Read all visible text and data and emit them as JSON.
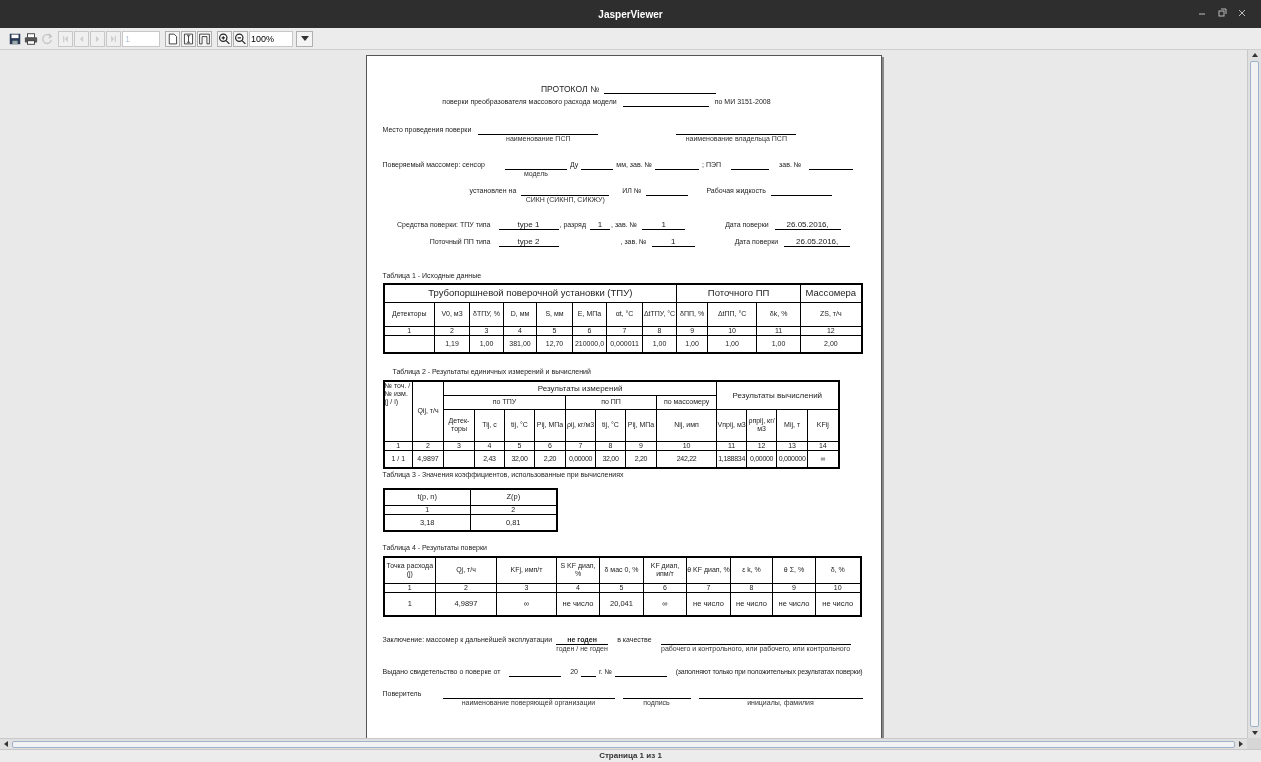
{
  "window": {
    "title": "JasperViewer"
  },
  "toolbar": {
    "buttons": [
      {
        "kind": "save",
        "disabled": false
      },
      {
        "kind": "print",
        "disabled": false
      },
      {
        "kind": "reload",
        "disabled": true
      },
      {
        "kind": "first",
        "disabled": true
      },
      {
        "kind": "previous",
        "disabled": true
      },
      {
        "kind": "next",
        "disabled": true
      },
      {
        "kind": "last",
        "disabled": true
      }
    ],
    "page_field": {
      "value": "1",
      "disabled": true
    },
    "view_buttons": [
      {
        "kind": "actual-size"
      },
      {
        "kind": "fit-page"
      },
      {
        "kind": "fit-width"
      }
    ],
    "zoom_buttons": [
      {
        "kind": "zoom-in"
      },
      {
        "kind": "zoom-out"
      }
    ],
    "zoom": "100%"
  },
  "report": {
    "heading": "ПРОТОКОЛ №",
    "model_line": {
      "before": "поверки преобразователя массового расхода модели",
      "after": "по МИ 3151-2008"
    },
    "place": {
      "label": "Место проведения поверки",
      "captions": [
        "наименование ПСП",
        "наименование владельца ПСП"
      ]
    },
    "meter": {
      "label": "Поверяемый массомер: сенсор",
      "model_caption": "модель",
      "du": "Ду",
      "mm_serial": "мм, зав. №",
      "pep": "; ПЭП",
      "serial": "зав. №"
    },
    "installed": {
      "label": "установлен на",
      "caption": "СИКН (СИКНП, СИКЖУ)",
      "il": "ИЛ №",
      "fluid": "Рабочая жидкость"
    },
    "means": [
      {
        "label": "Средства поверки: ТПУ типа",
        "type": "type 1",
        "grade_label": ", разряд",
        "grade": "1",
        "serial_label": ", зав. №",
        "serial": "1",
        "date_label": "Дата поверки",
        "date": "26.05.2016,"
      },
      {
        "label": "Поточный ПП типа",
        "type": "type 2",
        "serial_label": ", зав. №",
        "serial": "1",
        "date_label": "Дата поверки",
        "date": "26.05.2016,"
      }
    ],
    "table1": {
      "caption": "Таблица 1 - Исходные данные",
      "groups": [
        "Трубопоршневой поверочной установки (ТПУ)",
        "Поточного ПП",
        "Массомера"
      ],
      "columns": [
        "Детекторы",
        "V0, м3",
        "δТПУ, %",
        "D, мм",
        "S, мм",
        "E, МПа",
        "αt, °C",
        "ΔtТПУ, °C",
        "δПП, %",
        "ΔtПП, °C",
        "δk, %",
        "ZS, т/ч"
      ],
      "numbers": [
        "1",
        "2",
        "3",
        "4",
        "5",
        "6",
        "7",
        "8",
        "9",
        "10",
        "11",
        "12"
      ],
      "row": [
        "1,19",
        "1,00",
        "381,00",
        "12,70",
        "210000,0",
        "0,000011",
        "1,00",
        "1,00",
        "1,00",
        "1,00",
        "2,00"
      ]
    },
    "table2": {
      "caption": "Таблица 2 - Результаты единичных измерений и вычислений",
      "point_header": "№ точ. / № изм. (j / i)",
      "flow_header": "Qij, т/ч",
      "measured": "Результаты измерений",
      "computed": "Результаты вычислений",
      "subgroups": [
        "по ТПУ",
        "по ПП",
        "по массомеру"
      ],
      "columns": [
        "Детек-торы",
        "Tij, с",
        "tij, °C",
        "Pij, МПа",
        "ρij, кг/м3",
        "tij, °C",
        "Pij, МПа",
        "Nij, имп",
        "Vпрij, м3",
        "ρпрij, кг/м3",
        "Mij, т",
        "KFij"
      ],
      "numbers": [
        "1",
        "2",
        "3",
        "4",
        "5",
        "6",
        "7",
        "8",
        "9",
        "10",
        "11",
        "12",
        "13",
        "14"
      ],
      "row": {
        "point": "1 / 1",
        "flow": "4,9897",
        "values": [
          "2,43",
          "32,00",
          "2,20",
          "0,00000",
          "32,00",
          "2,20",
          "242,22",
          "1,188834",
          "0,00000",
          "0,000000",
          "∞"
        ]
      }
    },
    "table3": {
      "caption": "Таблица 3 - Значения коэффициентов, использованные при вычислениях",
      "columns": [
        "t(p, n)",
        "Z(p)"
      ],
      "numbers": [
        "1",
        "2"
      ],
      "row": [
        "3,18",
        "0,81"
      ]
    },
    "table4": {
      "caption": "Таблица 4 - Результаты поверки",
      "columns": [
        "Точка расхода (j)",
        "Qj, т/ч",
        "KFj, имп/т",
        "S KF диап, %",
        "δ мас 0, %",
        "KF диап, ипм/т",
        "θ KF диап, %",
        "ε k, %",
        "θ Σ, %",
        "δ, %"
      ],
      "numbers": [
        "1",
        "2",
        "3",
        "4",
        "5",
        "6",
        "7",
        "8",
        "9",
        "10"
      ],
      "row": [
        "1",
        "4,9897",
        "∞",
        "не число",
        "20,041",
        "∞",
        "не число",
        "не число",
        "не число",
        "не число"
      ]
    },
    "conclusion": {
      "label": "Заключение: массомер к дальнейшей эксплуатации",
      "verdict": "не годен",
      "verdict_caption": "годен / не годен",
      "as_label": "в качестве",
      "as_caption": "рабочего и контрольного, или рабочего, или контрольного"
    },
    "certificate": {
      "label": "Выдано свидетельство о поверке от",
      "year": "20",
      "number_label": "г. №",
      "note": "(заполняют только при положительных результатах поверки)"
    },
    "verifier": {
      "label": "Поверитель",
      "captions": [
        "наименование поверяющей организации",
        "подпись",
        "инициалы, фамилия"
      ]
    }
  },
  "status_bar": "Страница 1 из 1"
}
